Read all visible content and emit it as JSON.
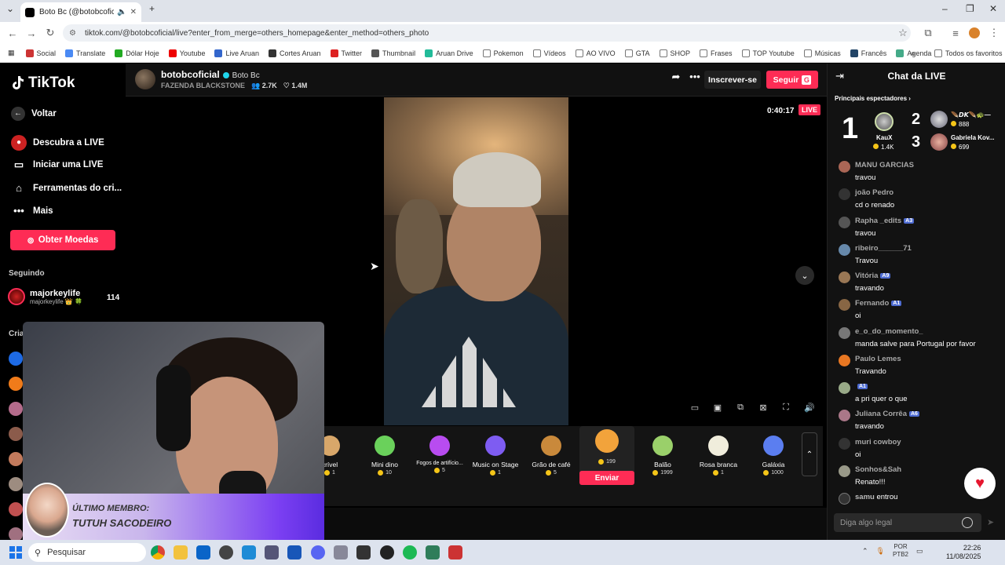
{
  "browser": {
    "tab_title": "Boto Bc (@botobcoficial) c",
    "url": "tiktok.com/@botobcoficial/live?enter_from_merge=others_homepage&enter_method=others_photo",
    "bookmarks": [
      "Social",
      "Translate",
      "Dólar Hoje",
      "Youtube",
      "Live Aruan",
      "Cortes Aruan",
      "Twitter",
      "Thumbnail",
      "Aruan Drive",
      "Pokemon",
      "Vídeos",
      "AO VIVO",
      "GTA",
      "SHOP",
      "Frases",
      "TOP Youtube",
      "Músicas",
      "Francês",
      "Agenda"
    ],
    "all_favorites": "Todos os favoritos"
  },
  "sidebar": {
    "logo": "TikTok",
    "back": "Voltar",
    "items": [
      {
        "label": "Descubra a LIVE"
      },
      {
        "label": "Iniciar uma LIVE"
      },
      {
        "label": "Ferramentas do cri..."
      },
      {
        "label": "Mais"
      }
    ],
    "coins_button": "Obter Moedas",
    "following_title": "Seguindo",
    "following": {
      "name": "majorkeylife",
      "sub": "majorkeylife 👑 🍀",
      "count": "114"
    },
    "creators_label": "Cria"
  },
  "stream": {
    "host_name": "botobcoficial",
    "host_nick": "Boto Bc",
    "host_tag": "FAZENDA BLACKSTONE",
    "viewers": "2.7K",
    "likes": "1.4M",
    "subscribe": "Inscrever-se",
    "follow": "Seguir",
    "follow_badge": "G",
    "timer": "0:40:17",
    "live_badge": "LIVE"
  },
  "gifts": [
    {
      "name": "crível",
      "price": "1"
    },
    {
      "name": "Mini dino",
      "price": "10"
    },
    {
      "name": "Fogos de artifício...",
      "price": "5"
    },
    {
      "name": "Music on Stage",
      "price": "1"
    },
    {
      "name": "Grão de café",
      "price": "5"
    },
    {
      "name": "",
      "price": "199"
    },
    {
      "name": "Balão",
      "price": "1999"
    },
    {
      "name": "Rosa branca",
      "price": "1"
    },
    {
      "name": "Galáxia",
      "price": "1000"
    }
  ],
  "send_label": "Enviar",
  "overlay": {
    "member_line1": "ÚLTIMO MEMBRO:",
    "member_line2": "TUTUH SACODEIRO"
  },
  "chat": {
    "title": "Chat da LIVE",
    "top_viewers_label": "Principais espectadores",
    "rank1": {
      "rank": "1",
      "name": "KauX",
      "coins": "1.4K"
    },
    "rank2": {
      "rank": "2",
      "name": "🪶𝘿𝙆🪶🐢—",
      "coins": "888"
    },
    "rank3": {
      "rank": "3",
      "name": "Gabriela Kov...",
      "coins": "699"
    },
    "messages": [
      {
        "name": "MANU GARCIAS",
        "tag": "",
        "text": "travou"
      },
      {
        "name": "joão Pedro",
        "tag": "",
        "text": "cd o renado"
      },
      {
        "name": "Rapha _edits",
        "tag": "A3",
        "text": "travou"
      },
      {
        "name": "ribeiro______71",
        "tag": "",
        "text": "Travou"
      },
      {
        "name": "Vitória",
        "tag": "A9",
        "text": "travando"
      },
      {
        "name": "Fernando",
        "tag": "A1",
        "text": "oi"
      },
      {
        "name": "e_o_do_momento_",
        "tag": "",
        "text": "manda salve para Portugal por favor"
      },
      {
        "name": "Paulo Lemes",
        "tag": "",
        "text": "Travando"
      },
      {
        "name": "",
        "tag": "A1",
        "text": "a pri quer o que"
      },
      {
        "name": "Juliana Corrêa",
        "tag": "A6",
        "text": "travando"
      },
      {
        "name": "muri cowboy",
        "tag": "",
        "text": "oi"
      },
      {
        "name": "Sonhos&Sah",
        "tag": "",
        "text": "Renato!!!"
      },
      {
        "name": "samu",
        "tag": "",
        "text": "entrou"
      }
    ],
    "input_placeholder": "Diga algo legal"
  },
  "taskbar": {
    "search": "Pesquisar",
    "lang": "POR",
    "lang2": "PTB2",
    "time": "22:26",
    "date": "11/08/2025"
  }
}
